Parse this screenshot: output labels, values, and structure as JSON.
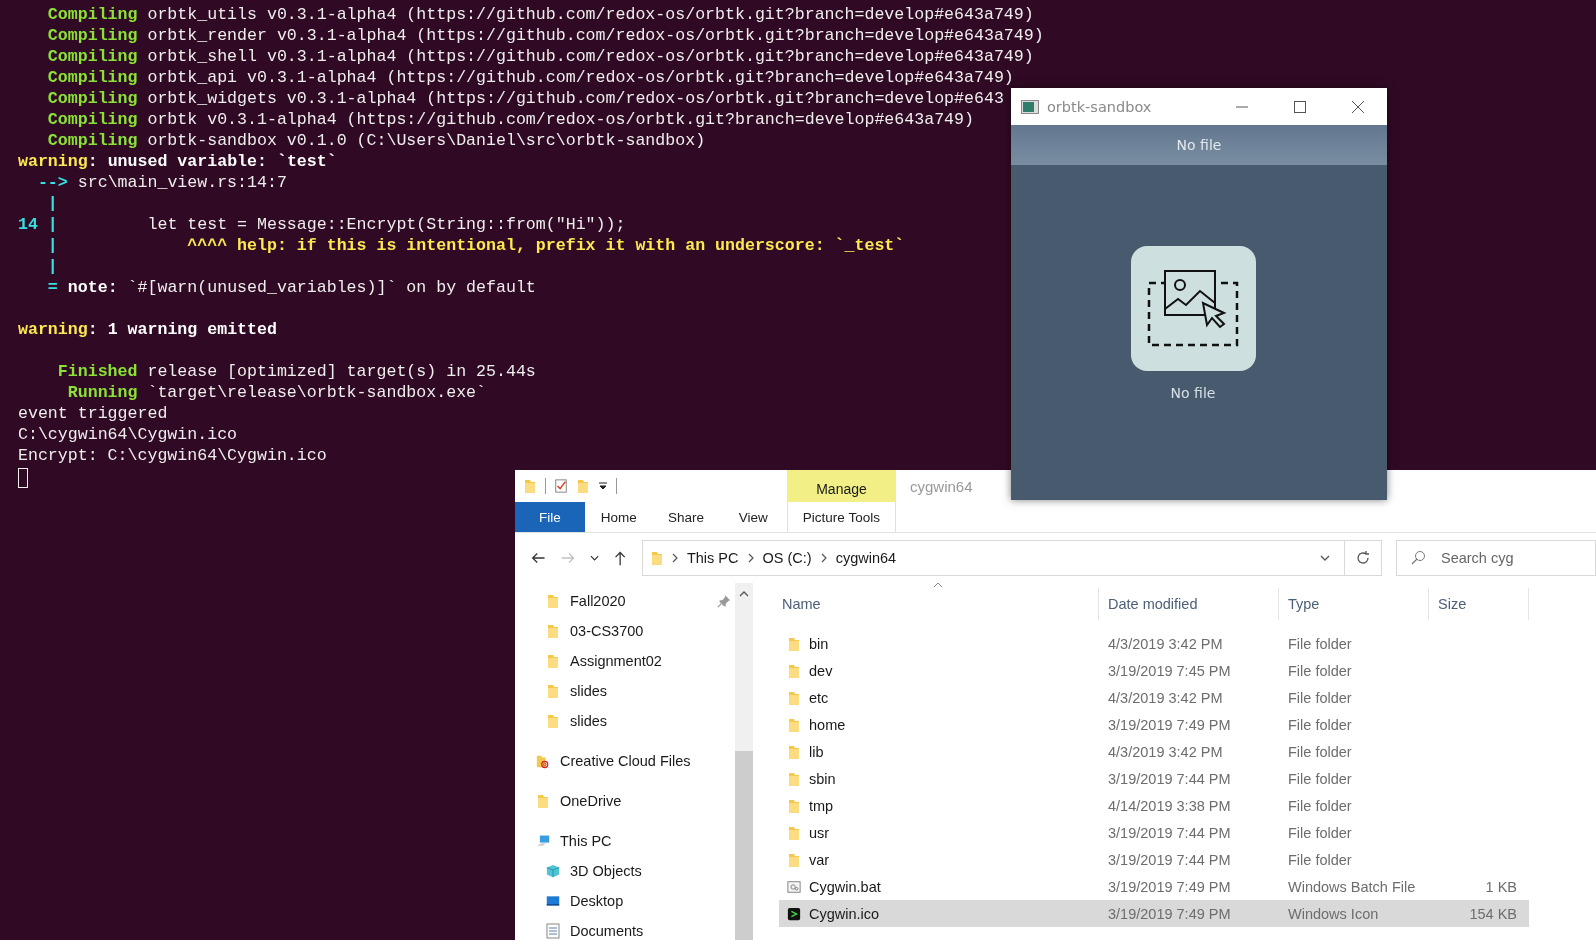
{
  "terminal": {
    "blocks": [
      [
        {
          "spans": [
            {
              "text": "   Compiling",
              "kind": "green"
            },
            {
              "text": " orbtk_utils v0.3.1-alpha4 (https://github.com/redox-os/orbtk.git?branch=develop#e643a749)",
              "kind": "plain"
            }
          ]
        },
        {
          "spans": [
            {
              "text": "   Compiling",
              "kind": "green"
            },
            {
              "text": " orbtk_render v0.3.1-alpha4 (https://github.com/redox-os/orbtk.git?branch=develop#e643a749)",
              "kind": "plain"
            }
          ]
        },
        {
          "spans": [
            {
              "text": "   Compiling",
              "kind": "green"
            },
            {
              "text": " orbtk_shell v0.3.1-alpha4 (https://github.com/redox-os/orbtk.git?branch=develop#e643a749)",
              "kind": "plain"
            }
          ]
        },
        {
          "spans": [
            {
              "text": "   Compiling",
              "kind": "green"
            },
            {
              "text": " orbtk_api v0.3.1-alpha4 (https://github.com/redox-os/orbtk.git?branch=develop#e643a749)",
              "kind": "plain"
            }
          ]
        },
        {
          "spans": [
            {
              "text": "   Compiling",
              "kind": "green"
            },
            {
              "text": " orbtk_widgets v0.3.1-alpha4 (https://github.com/redox-os/orbtk.git?branch=develop#e643",
              "kind": "plain"
            }
          ]
        },
        {
          "spans": [
            {
              "text": "   Compiling",
              "kind": "green"
            },
            {
              "text": " orbtk v0.3.1-alpha4 (https://github.com/redox-os/orbtk.git?branch=develop#e643a749)",
              "kind": "plain"
            }
          ]
        },
        {
          "spans": [
            {
              "text": "   Compiling",
              "kind": "green"
            },
            {
              "text": " orbtk-sandbox v0.1.0 (C:\\Users\\Daniel\\src\\orbtk-sandbox)",
              "kind": "plain"
            }
          ]
        },
        {
          "spans": [
            {
              "text": "warning",
              "kind": "yellow"
            },
            {
              "text": ": unused variable: `test`",
              "kind": "white"
            }
          ]
        },
        {
          "spans": [
            {
              "text": "  -->",
              "kind": "cyan"
            },
            {
              "text": " src\\main_view.rs:14:7",
              "kind": "plain"
            }
          ]
        },
        {
          "spans": [
            {
              "text": "   |",
              "kind": "cyan"
            }
          ]
        },
        {
          "spans": [
            {
              "text": "14 |",
              "kind": "cyan"
            },
            {
              "text": "         let test = Message::Encrypt(String::from(\"Hi\"));",
              "kind": "plain"
            }
          ]
        },
        {
          "spans": [
            {
              "text": "   |",
              "kind": "cyan"
            },
            {
              "text": "             ^^^^ help: if this is intentional, prefix it with an underscore: `_test`",
              "kind": "yellow"
            }
          ]
        },
        {
          "spans": [
            {
              "text": "   |",
              "kind": "cyan"
            }
          ]
        },
        {
          "spans": [
            {
              "text": "   =",
              "kind": "cyan"
            },
            {
              "text": " note:",
              "kind": "white"
            },
            {
              "text": " `#[warn(unused_variables)]` on by default",
              "kind": "plain"
            }
          ]
        }
      ],
      [
        {
          "spans": [
            {
              "text": "warning",
              "kind": "yellow"
            },
            {
              "text": ": 1 warning emitted",
              "kind": "white"
            }
          ]
        }
      ],
      [
        {
          "spans": [
            {
              "text": "    Finished",
              "kind": "green"
            },
            {
              "text": " release [optimized] target(s) in 25.44s",
              "kind": "plain"
            }
          ]
        },
        {
          "spans": [
            {
              "text": "     Running",
              "kind": "green"
            },
            {
              "text": " `target\\release\\orbtk-sandbox.exe`",
              "kind": "plain"
            }
          ]
        },
        {
          "spans": [
            {
              "text": "event triggered",
              "kind": "plain"
            }
          ]
        },
        {
          "spans": [
            {
              "text": "C:\\cygwin64\\Cygwin.ico",
              "kind": "plain"
            }
          ]
        },
        {
          "spans": [
            {
              "text": "Encrypt: C:\\cygwin64\\Cygwin.ico",
              "kind": "plain"
            }
          ]
        }
      ]
    ]
  },
  "app_window": {
    "title": "orbtk-sandbox",
    "header": "No file",
    "drop_label": "No file"
  },
  "explorer": {
    "title": "cygwin64",
    "context_group": "Manage",
    "ribbon_tabs": [
      {
        "label": "File",
        "kind": "file"
      },
      {
        "label": "Home",
        "kind": "tab"
      },
      {
        "label": "Share",
        "kind": "tab"
      },
      {
        "label": "View",
        "kind": "tab"
      },
      {
        "label": "Picture Tools",
        "kind": "context"
      }
    ],
    "nav_buttons": [
      {
        "kind": "back",
        "disabled": false
      },
      {
        "kind": "forward",
        "disabled": true
      },
      {
        "kind": "recent",
        "disabled": false
      },
      {
        "kind": "up",
        "disabled": false
      }
    ],
    "breadcrumb": [
      "This PC",
      "OS (C:)",
      "cygwin64"
    ],
    "search": {
      "placeholder": "Search cyg"
    },
    "quick_access": [
      {
        "label": "Fall2020",
        "pinned": true
      },
      {
        "label": "03-CS3700",
        "pinned": false
      },
      {
        "label": "Assignment02",
        "pinned": false
      },
      {
        "label": "slides",
        "pinned": false
      },
      {
        "label": "slides",
        "pinned": false
      }
    ],
    "locations": [
      {
        "label": "Creative Cloud Files",
        "kind": "cloud"
      },
      {
        "label": "OneDrive",
        "kind": "folder"
      },
      {
        "label": "This PC",
        "kind": "pc",
        "children": [
          {
            "label": "3D Objects",
            "kind": "cube"
          },
          {
            "label": "Desktop",
            "kind": "desktop"
          },
          {
            "label": "Documents",
            "kind": "documents"
          }
        ]
      }
    ],
    "columns": [
      "Name",
      "Date modified",
      "Type",
      "Size"
    ],
    "rows": [
      {
        "name": "bin",
        "date": "4/3/2019 3:42 PM",
        "type": "File folder",
        "kind": "folder",
        "selected": false
      },
      {
        "name": "dev",
        "date": "3/19/2019 7:45 PM",
        "type": "File folder",
        "kind": "folder",
        "selected": false
      },
      {
        "name": "etc",
        "date": "4/3/2019 3:42 PM",
        "type": "File folder",
        "kind": "folder",
        "selected": false
      },
      {
        "name": "home",
        "date": "3/19/2019 7:49 PM",
        "type": "File folder",
        "kind": "folder",
        "selected": false
      },
      {
        "name": "lib",
        "date": "4/3/2019 3:42 PM",
        "type": "File folder",
        "kind": "folder",
        "selected": false
      },
      {
        "name": "sbin",
        "date": "3/19/2019 7:44 PM",
        "type": "File folder",
        "kind": "folder",
        "selected": false
      },
      {
        "name": "tmp",
        "date": "4/14/2019 3:38 PM",
        "type": "File folder",
        "kind": "folder",
        "selected": false
      },
      {
        "name": "usr",
        "date": "3/19/2019 7:44 PM",
        "type": "File folder",
        "kind": "folder",
        "selected": false
      },
      {
        "name": "var",
        "date": "3/19/2019 7:44 PM",
        "type": "File folder",
        "kind": "folder",
        "selected": false
      },
      {
        "name": "Cygwin.bat",
        "date": "3/19/2019 7:49 PM",
        "type": "Windows Batch File",
        "size": "1 KB",
        "kind": "batch",
        "selected": false
      },
      {
        "name": "Cygwin.ico",
        "date": "3/19/2019 7:49 PM",
        "type": "Windows Icon",
        "size": "154 KB",
        "kind": "icon",
        "selected": true
      }
    ]
  }
}
